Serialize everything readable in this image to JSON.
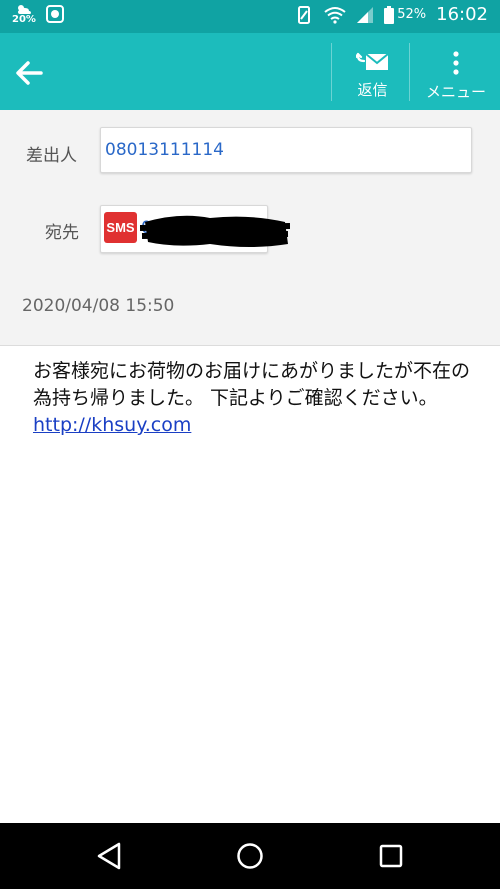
{
  "status_bar": {
    "left_percent": "20%",
    "battery": "52%",
    "time": "16:02"
  },
  "app_bar": {
    "reply_label": "返信",
    "menu_label": "メニュー"
  },
  "header": {
    "sender_label": "差出人",
    "sender_number": "08013111114",
    "recipient_label": "宛先",
    "recipient_badge": "SMS",
    "recipient_number_visible": "0",
    "date": "2020/04/08 15:50"
  },
  "message": {
    "text": "お客様宛にお荷物のお届けにあがりましたが不在の為持ち帰りました。 下記よりご確認ください。",
    "link": "http://khsuy.com"
  },
  "colors": {
    "status_bar": "#10a3a3",
    "app_bar": "#1cbcbc",
    "link": "#1a3fc4",
    "number": "#2a68c8",
    "sms_badge": "#e03131"
  }
}
